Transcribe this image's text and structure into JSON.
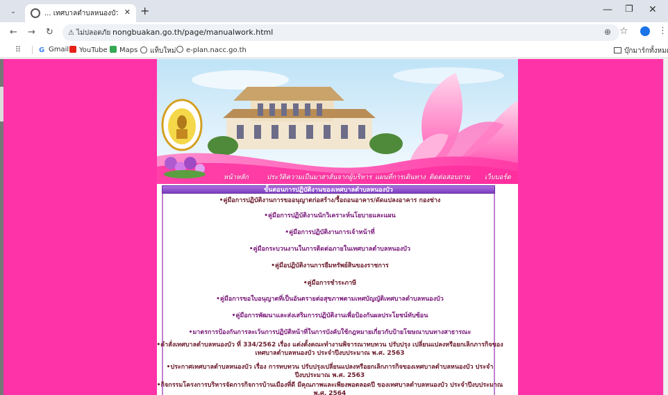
{
  "browser": {
    "tab_title": "... เทศบาลตำบลหนองบัว NoNGBU",
    "url": "nongbuakan.go.th/page/manualwork.html",
    "site_info": "ไม่ปลอดภัย",
    "bookmarks": [
      "Gmail",
      "YouTube",
      "Maps",
      "แท็บใหม่",
      "e-plan.nacc.go.th"
    ],
    "bookmarks_right": "บุ๊กมาร์กทั้งหมด"
  },
  "menu": {
    "items": [
      "หน้าหลัก",
      "ประวัติความเป็นมา",
      "สาส์นจากผู้บริหาร",
      "แผนที่การเดินทาง",
      "ติดต่อสอบถาม",
      "เว็บบอร์ด"
    ]
  },
  "content": {
    "header": "ขั้นตอนการปฏิบัติงานของเทศบาลตำบลหนองบัว",
    "links": [
      "•คู่มือการปฏิบัติงานการขออนุญาตก่อสร้าง/รื้อถอนอาคาร/ดัดแปลงอาคาร กองช่าง",
      "•คู่มือการปฏิบัติงานนักวิเคราะห์นโยบายและแผน",
      "•คู่มือการปฏิบัติงานการเจ้าหน้าที่",
      "•คู่มือกระบวนงานในการติดต่อภายในเทศบาลตำบลหนองบัว",
      "•คู่มือปฏิบัติงานการยืมทรัพย์สินของราชการ",
      "•คู่มือการชำระภาษี",
      "•คู่มือการขอใบอนุญาตที่เป็นอันตรายต่อสุขภาพตามเทศบัญญัติเทศบาลตำบลหนองบัว",
      "•คู่มือการพัฒนาและส่งเสริมการปฏิบัติงานเพื่อป้องกันผลประโยชน์ทับซ้อน",
      "•มาตรการป้องกันการละเว้นการปฏิบัติหน้าที่ในการบังคับใช้กฎหมายเกี่ยวกับป้ายโฆษณาบนทางสาธารณะ",
      "•คำสั่งเทศบาลตำบลหนองบัว ที่ 334/2562 เรื่อง แต่งตั้งคณะทำงานพิจารณาทบทวน ปรับปรุง เปลี่ยนแปลงหรือยกเลิกภารกิจของเทศบาลตำบลหนองบัว ประจำปีงบประมาณ พ.ศ. 2563",
      "•ประกาศเทศบาลตำบลหนองบัว เรื่อง การทบทวน ปรับปรุงเปลี่ยนแปลงหรือยกเลิกภารกิจของเทศบาลตำบลหนองบัว ประจำปีงบประมาณ พ.ศ. 2563",
      "•กิจกรรมโครงการบริหารจัดการกิจการบ้านเมืองที่ดี มีคุณภาพและเพียงพอตลอดปี ของเทศบาลตำบลหนองบัว ประจำปีงบประมาณ พ.ศ. 2564"
    ]
  },
  "colors": {
    "page_background": "#ff33a8",
    "header_bar": "#8a4ad0",
    "link_dark": "#6a1a2a",
    "link_purple": "#7a1a7a"
  }
}
